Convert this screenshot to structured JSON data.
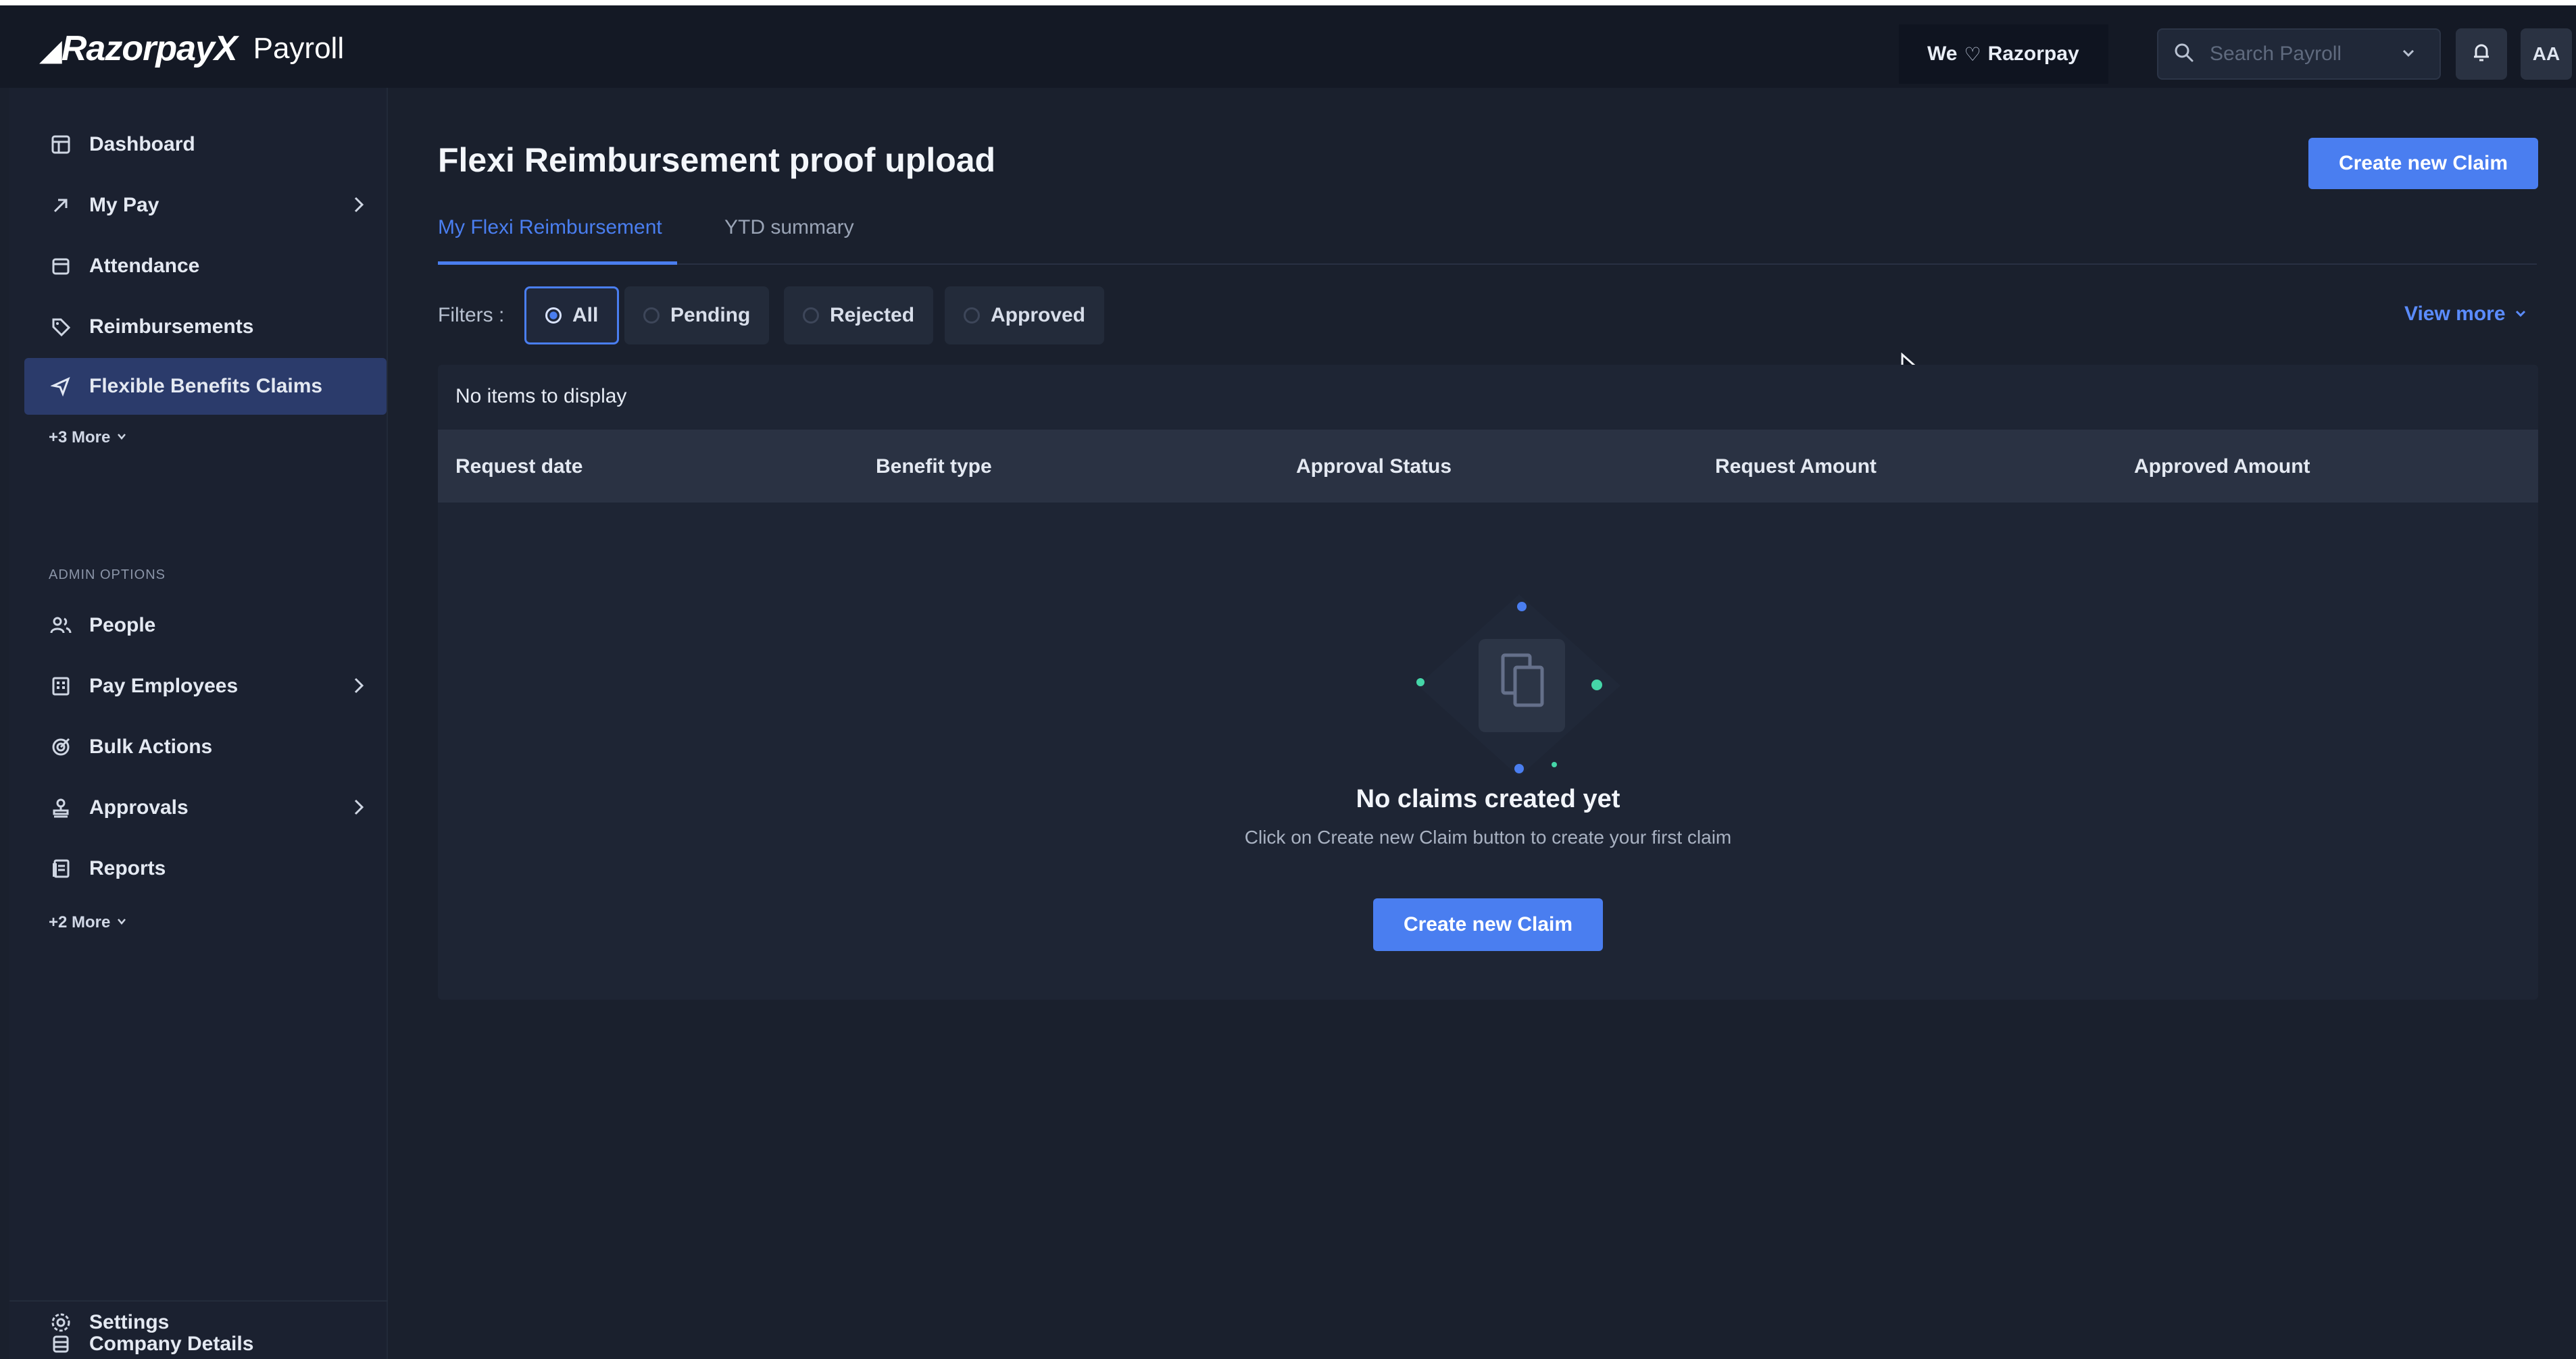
{
  "header": {
    "brand": "RazorpayX",
    "product": "Payroll",
    "tagline_prefix": "We",
    "tagline_company": "Razorpay",
    "search_placeholder": "Search Payroll",
    "avatar_initials": "AA"
  },
  "sidebar": {
    "items": [
      {
        "label": "Dashboard",
        "icon": "layout-icon"
      },
      {
        "label": "My Pay",
        "icon": "arrow-up-right-icon"
      },
      {
        "label": "Attendance",
        "icon": "calendar-icon"
      },
      {
        "label": "Reimbursements",
        "icon": "tag-icon"
      },
      {
        "label": "Flexible Benefits Claims",
        "icon": "send-icon"
      }
    ],
    "more_1": "+3 More",
    "section_label": "ADMIN OPTIONS",
    "admin_items": [
      {
        "label": "People",
        "icon": "people-icon"
      },
      {
        "label": "Pay Employees",
        "icon": "building-icon"
      },
      {
        "label": "Bulk Actions",
        "icon": "target-icon"
      },
      {
        "label": "Approvals",
        "icon": "stamp-icon"
      },
      {
        "label": "Reports",
        "icon": "document-icon"
      }
    ],
    "more_2": "+2 More",
    "bottom_items": [
      {
        "label": "Company Details",
        "icon": "company-icon"
      },
      {
        "label": "Settings",
        "icon": "gear-icon"
      }
    ]
  },
  "main": {
    "title": "Flexi Reimbursement proof upload",
    "create_claim_label": "Create new Claim",
    "tabs": [
      {
        "label": "My Flexi Reimbursement",
        "active": true
      },
      {
        "label": "YTD summary",
        "active": false
      }
    ],
    "filters_label": "Filters :",
    "filters": [
      {
        "label": "All",
        "selected": true
      },
      {
        "label": "Pending",
        "selected": false
      },
      {
        "label": "Rejected",
        "selected": false
      },
      {
        "label": "Approved",
        "selected": false
      }
    ],
    "view_more": "View more",
    "table": {
      "no_items": "No items to display",
      "columns": [
        "Request date",
        "Benefit type",
        "Approval Status",
        "Request Amount",
        "Approved Amount"
      ]
    },
    "empty_state": {
      "title": "No claims created yet",
      "description": "Click on Create new Claim button to create your first claim",
      "button": "Create new Claim"
    }
  },
  "colors": {
    "accent": "#4a7ef0",
    "active_nav": "#2b3b6b",
    "background": "#1a202d"
  }
}
